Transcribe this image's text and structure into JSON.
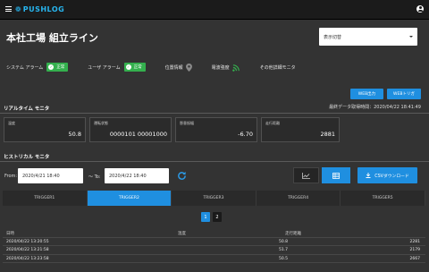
{
  "app": {
    "logo_text": "PUSHLOG"
  },
  "page": {
    "title": "本社工場 組立ライン"
  },
  "display_select": {
    "value": "表示切替"
  },
  "status": [
    {
      "label": "システム アラーム",
      "badge": "正常"
    },
    {
      "label": "ユーザ アラーム",
      "badge": "正常"
    },
    {
      "label": "位置情報"
    },
    {
      "label": "電波強度"
    },
    {
      "label": "その他詳細モニタ"
    }
  ],
  "buttons": {
    "web_output": "WEB出力",
    "web_trigger": "WEBトリガ",
    "csv_download": "CSVダウンロード"
  },
  "realtime": {
    "title": "リアルタイム モニタ",
    "last_time_label": "最終データ取得時間：",
    "last_time_value": "2020/04/22 18:41:49",
    "cards": [
      {
        "label": "温度",
        "value": "50.8"
      },
      {
        "label": "運転状態",
        "value": "0000101  00001000"
      },
      {
        "label": "懸垂振幅",
        "value": "-6.70"
      },
      {
        "label": "走行距離",
        "value": "2881"
      }
    ]
  },
  "history": {
    "title": "ヒストリカル モニタ",
    "from_label": "From:",
    "from_value": "2020/4/21 18:40",
    "to_label": "～ To:",
    "to_value": "2020/4/22 18:40",
    "tabs": [
      "TRIGGER1",
      "TRIGGER2",
      "TRIGGER3",
      "TRIGGER4",
      "TRIGGER5"
    ],
    "active_tab": 1,
    "pages": [
      "1",
      "2"
    ],
    "columns": [
      "日時",
      "温度",
      "走行距離"
    ],
    "rows": [
      [
        "2020/04/22 13:20:55",
        "50.8",
        "2281"
      ],
      [
        "2020/04/22 13:21:58",
        "51.7",
        "2179"
      ],
      [
        "2020/04/22 13:23:58",
        "50.5",
        "2667"
      ]
    ]
  },
  "colors": {
    "accent": "#1f8fe0",
    "ok": "#34b04e",
    "background": "#333333",
    "topbar": "#1b1b1b"
  }
}
